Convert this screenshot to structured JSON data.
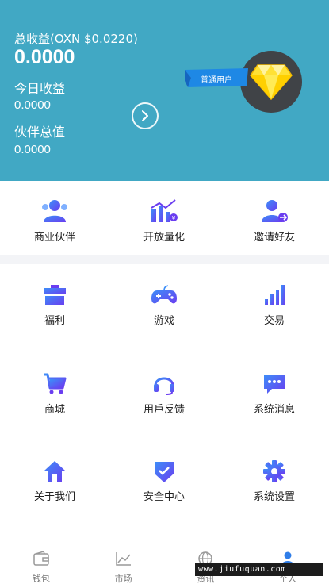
{
  "header": {
    "total_label": "总收益(OXN $0.0220)",
    "total_value": "0.0000",
    "today_label": "今日收益",
    "today_value": "0.0000",
    "partner_label": "伙伴总值",
    "partner_value": "0.0000",
    "badge_text": "普通用户"
  },
  "top_items": [
    {
      "label": "商业伙伴",
      "icon": "business-partner-icon"
    },
    {
      "label": "开放量化",
      "icon": "open-quant-icon"
    },
    {
      "label": "邀请好友",
      "icon": "invite-friend-icon"
    }
  ],
  "grid_items": [
    {
      "label": "福利",
      "icon": "gift-icon"
    },
    {
      "label": "游戏",
      "icon": "gamepad-icon"
    },
    {
      "label": "交易",
      "icon": "signal-bars-icon"
    },
    {
      "label": "商城",
      "icon": "cart-icon"
    },
    {
      "label": "用戶反馈",
      "icon": "headset-icon"
    },
    {
      "label": "系统消息",
      "icon": "message-icon"
    },
    {
      "label": "关于我们",
      "icon": "home-icon"
    },
    {
      "label": "安全中心",
      "icon": "shield-check-icon"
    },
    {
      "label": "系统设置",
      "icon": "gear-icon"
    }
  ],
  "bottom_nav": [
    {
      "label": "钱包",
      "icon": "wallet-icon"
    },
    {
      "label": "市场",
      "icon": "chart-icon"
    },
    {
      "label": "资讯",
      "icon": "globe-icon"
    },
    {
      "label": "个人",
      "icon": "user-icon"
    }
  ],
  "watermark": "www.jiufuquan.com",
  "colors": {
    "header_bg": "#41a8c4",
    "icon_gradient_start": "#3d8ef8",
    "icon_gradient_end": "#6a3df0",
    "badge_blue": "#1e88e5",
    "diamond_yellow": "#ffe135"
  }
}
